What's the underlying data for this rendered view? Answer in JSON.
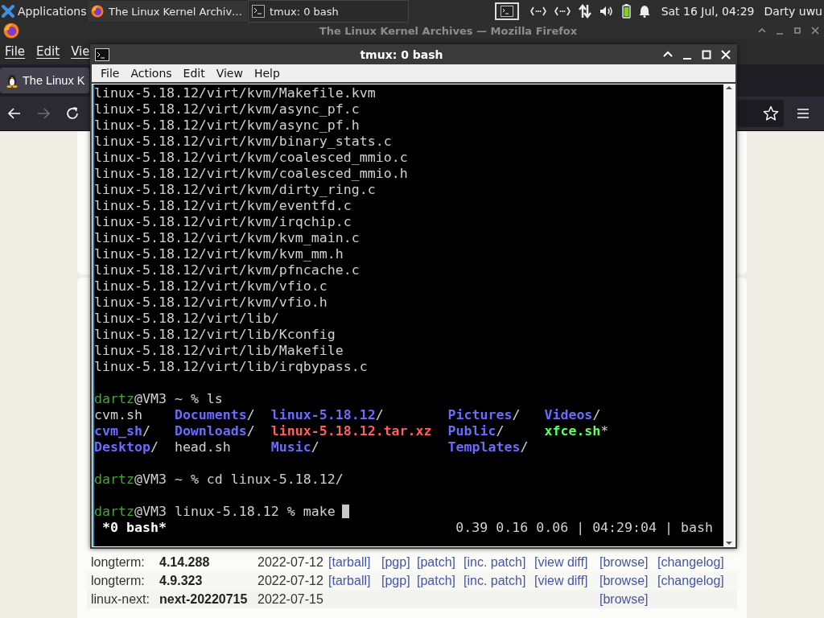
{
  "panel": {
    "apps_menu": "Applications",
    "tasks": [
      {
        "title": "The Linux Kernel Archiv…",
        "kind": "browser",
        "selected": false
      },
      {
        "title": "tmux: 0 bash",
        "kind": "terminal",
        "selected": true
      }
    ],
    "clock": "Sat 16 Jul, 04:29",
    "user": "Darty uwu"
  },
  "firefox": {
    "title": "The Linux Kernel Archives — Mozilla Firefox",
    "menu": [
      "File",
      "Edit",
      "Vie"
    ],
    "tab": "The Linux K",
    "nav": [
      {
        "kind": "back",
        "disabled": false
      },
      {
        "kind": "forward",
        "disabled": true
      },
      {
        "kind": "reload",
        "disabled": false
      }
    ],
    "releases": [
      {
        "label": "longterm:",
        "version": "4.14.288",
        "date": "2022-07-12",
        "links": [
          {
            "kind": "tarball",
            "text": "[tarball]"
          },
          {
            "kind": "pgp",
            "text": "[pgp]"
          },
          {
            "kind": "patch",
            "text": "[patch]"
          },
          {
            "kind": "inc_patch",
            "text": "[inc. patch]"
          },
          {
            "kind": "view_diff",
            "text": "[view diff]"
          },
          {
            "kind": "browse",
            "text": "[browse]"
          },
          {
            "kind": "changelog",
            "text": "[changelog]"
          }
        ]
      },
      {
        "label": "longterm:",
        "version": "4.9.323",
        "date": "2022-07-12",
        "links": [
          {
            "kind": "tarball",
            "text": "[tarball]"
          },
          {
            "kind": "pgp",
            "text": "[pgp]"
          },
          {
            "kind": "patch",
            "text": "[patch]"
          },
          {
            "kind": "inc_patch",
            "text": "[inc. patch]"
          },
          {
            "kind": "view_diff",
            "text": "[view diff]"
          },
          {
            "kind": "browse",
            "text": "[browse]"
          },
          {
            "kind": "changelog",
            "text": "[changelog]"
          }
        ]
      },
      {
        "label": "linux-next:",
        "version": "next-20220715",
        "date": "2022-07-15",
        "links": [
          {
            "kind": "browse",
            "text": "[browse]"
          }
        ]
      }
    ]
  },
  "terminal": {
    "title": "tmux: 0 bash",
    "menu": [
      "File",
      "Actions",
      "Edit",
      "View",
      "Help"
    ],
    "lines": [
      {
        "kind": "text",
        "text": "linux-5.18.12/virt/kvm/Makefile.kvm"
      },
      {
        "kind": "text",
        "text": "linux-5.18.12/virt/kvm/async_pf.c"
      },
      {
        "kind": "text",
        "text": "linux-5.18.12/virt/kvm/async_pf.h"
      },
      {
        "kind": "text",
        "text": "linux-5.18.12/virt/kvm/binary_stats.c"
      },
      {
        "kind": "text",
        "text": "linux-5.18.12/virt/kvm/coalesced_mmio.c"
      },
      {
        "kind": "text",
        "text": "linux-5.18.12/virt/kvm/coalesced_mmio.h"
      },
      {
        "kind": "text",
        "text": "linux-5.18.12/virt/kvm/dirty_ring.c"
      },
      {
        "kind": "text",
        "text": "linux-5.18.12/virt/kvm/eventfd.c"
      },
      {
        "kind": "text",
        "text": "linux-5.18.12/virt/kvm/irqchip.c"
      },
      {
        "kind": "text",
        "text": "linux-5.18.12/virt/kvm/kvm_main.c"
      },
      {
        "kind": "text",
        "text": "linux-5.18.12/virt/kvm/kvm_mm.h"
      },
      {
        "kind": "text",
        "text": "linux-5.18.12/virt/kvm/pfncache.c"
      },
      {
        "kind": "text",
        "text": "linux-5.18.12/virt/kvm/vfio.c"
      },
      {
        "kind": "text",
        "text": "linux-5.18.12/virt/kvm/vfio.h"
      },
      {
        "kind": "text",
        "text": "linux-5.18.12/virt/lib/"
      },
      {
        "kind": "text",
        "text": "linux-5.18.12/virt/lib/Kconfig"
      },
      {
        "kind": "text",
        "text": "linux-5.18.12/virt/lib/Makefile"
      },
      {
        "kind": "text",
        "text": "linux-5.18.12/virt/lib/irqbypass.c"
      },
      {
        "kind": "blank"
      },
      {
        "kind": "prompt",
        "user": "dartz",
        "rest": "@VM3 ~ % ls",
        "cursor": false
      },
      {
        "kind": "ls",
        "cells": [
          {
            "name": "cvm.sh",
            "kind": "file"
          },
          {
            "name": "Documents",
            "kind": "dir",
            "suffix": "/"
          },
          {
            "name": "linux-5.18.12",
            "kind": "dir",
            "suffix": "/"
          },
          {
            "name": "Pictures",
            "kind": "dir",
            "suffix": "/"
          },
          {
            "name": "Videos",
            "kind": "dir",
            "suffix": "/"
          }
        ]
      },
      {
        "kind": "ls",
        "cells": [
          {
            "name": "cvm_sh",
            "kind": "dir",
            "suffix": "/"
          },
          {
            "name": "Downloads",
            "kind": "dir",
            "suffix": "/"
          },
          {
            "name": "linux-5.18.12.tar.xz",
            "kind": "archive"
          },
          {
            "name": "Public",
            "kind": "dir",
            "suffix": "/"
          },
          {
            "name": "xfce.sh",
            "kind": "exec",
            "suffix": "*"
          }
        ]
      },
      {
        "kind": "ls",
        "cells": [
          {
            "name": "Desktop",
            "kind": "dir",
            "suffix": "/"
          },
          {
            "name": "head.sh",
            "kind": "file"
          },
          {
            "name": "Music",
            "kind": "dir",
            "suffix": "/"
          },
          {
            "name": "Templates",
            "kind": "dir",
            "suffix": "/"
          }
        ]
      },
      {
        "kind": "blank"
      },
      {
        "kind": "prompt",
        "user": "dartz",
        "rest": "@VM3 ~ % cd linux-5.18.12/",
        "cursor": false
      },
      {
        "kind": "blank"
      },
      {
        "kind": "prompt",
        "user": "dartz",
        "rest": "@VM3 linux-5.18.12 % make",
        "cursor": true
      }
    ],
    "status": {
      "window": "*0 bash*",
      "info": "0.39 0.16 0.06 | 04:29:04 | bash"
    }
  }
}
